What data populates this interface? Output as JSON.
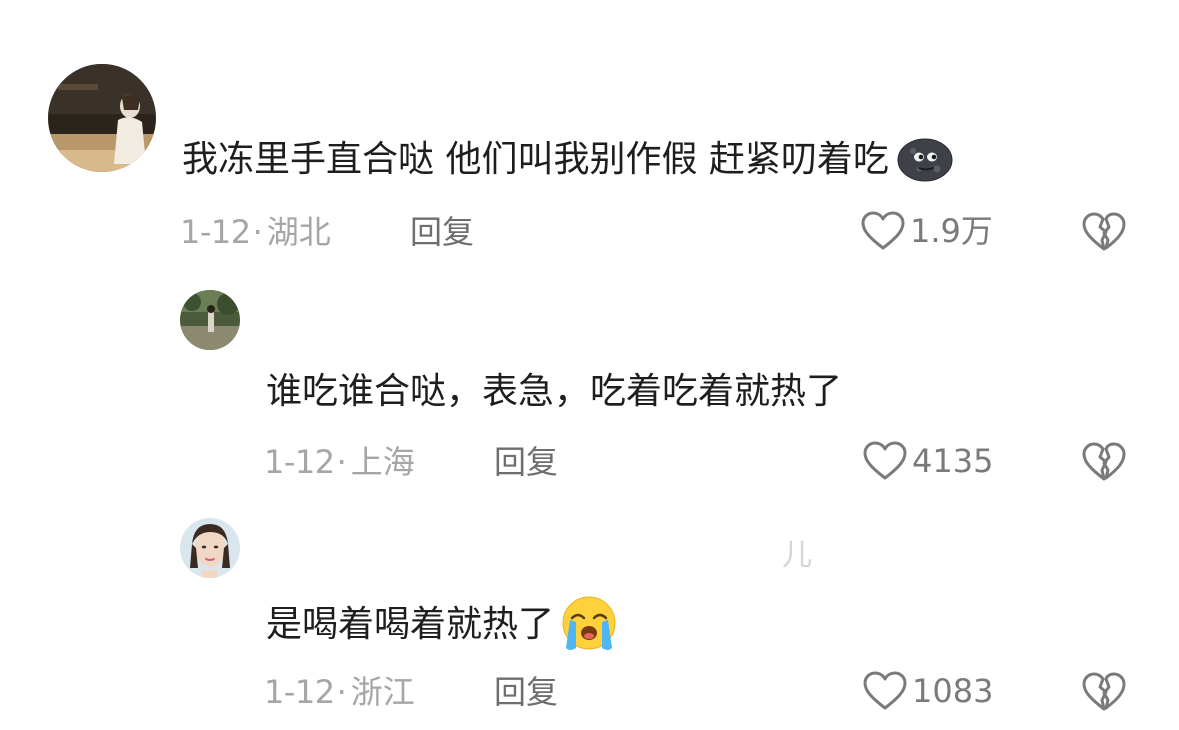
{
  "comments": [
    {
      "username": "",
      "content": "我冻里手直合哒 他们叫我别作假 赶紧叨着吃",
      "emoji": "new-moon-face-emoji",
      "date": "1-12",
      "separator": "·",
      "location": "湖北",
      "reply_label": "回复",
      "likes": "1.9万"
    },
    {
      "username": "",
      "content": "谁吃谁合哒，表急，吃着吃着就热了",
      "emoji": "",
      "date": "1-12",
      "separator": "·",
      "location": "上海",
      "reply_label": "回复",
      "likes": "4135"
    },
    {
      "username": "儿",
      "content": "是喝着喝着就热了",
      "emoji": "loudly-crying-face-emoji",
      "date": "1-12",
      "separator": "·",
      "location": "浙江",
      "reply_label": "回复",
      "likes": "1083"
    }
  ],
  "icons": {
    "like": "heart-outline-icon",
    "dislike": "broken-heart-icon"
  },
  "colors": {
    "text_primary": "#1e1e1e",
    "text_meta": "#a6a6a6",
    "icon_stroke": "#7a7a7a"
  }
}
